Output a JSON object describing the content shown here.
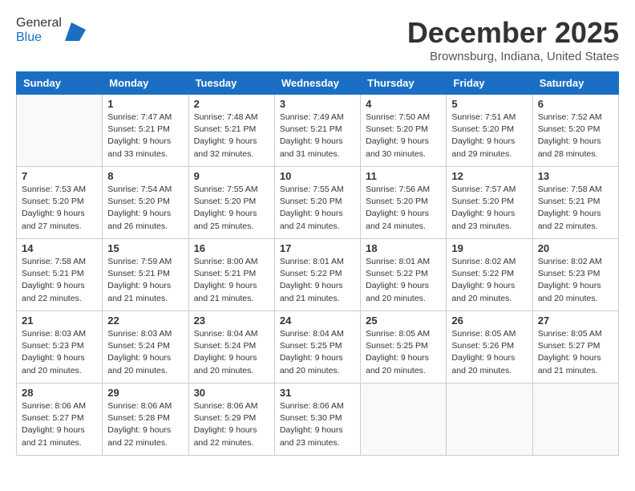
{
  "header": {
    "logo_general": "General",
    "logo_blue": "Blue",
    "month_title": "December 2025",
    "location": "Brownsburg, Indiana, United States"
  },
  "days_of_week": [
    "Sunday",
    "Monday",
    "Tuesday",
    "Wednesday",
    "Thursday",
    "Friday",
    "Saturday"
  ],
  "weeks": [
    [
      {
        "day": "",
        "info": ""
      },
      {
        "day": "1",
        "info": "Sunrise: 7:47 AM\nSunset: 5:21 PM\nDaylight: 9 hours\nand 33 minutes."
      },
      {
        "day": "2",
        "info": "Sunrise: 7:48 AM\nSunset: 5:21 PM\nDaylight: 9 hours\nand 32 minutes."
      },
      {
        "day": "3",
        "info": "Sunrise: 7:49 AM\nSunset: 5:21 PM\nDaylight: 9 hours\nand 31 minutes."
      },
      {
        "day": "4",
        "info": "Sunrise: 7:50 AM\nSunset: 5:20 PM\nDaylight: 9 hours\nand 30 minutes."
      },
      {
        "day": "5",
        "info": "Sunrise: 7:51 AM\nSunset: 5:20 PM\nDaylight: 9 hours\nand 29 minutes."
      },
      {
        "day": "6",
        "info": "Sunrise: 7:52 AM\nSunset: 5:20 PM\nDaylight: 9 hours\nand 28 minutes."
      }
    ],
    [
      {
        "day": "7",
        "info": "Sunrise: 7:53 AM\nSunset: 5:20 PM\nDaylight: 9 hours\nand 27 minutes."
      },
      {
        "day": "8",
        "info": "Sunrise: 7:54 AM\nSunset: 5:20 PM\nDaylight: 9 hours\nand 26 minutes."
      },
      {
        "day": "9",
        "info": "Sunrise: 7:55 AM\nSunset: 5:20 PM\nDaylight: 9 hours\nand 25 minutes."
      },
      {
        "day": "10",
        "info": "Sunrise: 7:55 AM\nSunset: 5:20 PM\nDaylight: 9 hours\nand 24 minutes."
      },
      {
        "day": "11",
        "info": "Sunrise: 7:56 AM\nSunset: 5:20 PM\nDaylight: 9 hours\nand 24 minutes."
      },
      {
        "day": "12",
        "info": "Sunrise: 7:57 AM\nSunset: 5:20 PM\nDaylight: 9 hours\nand 23 minutes."
      },
      {
        "day": "13",
        "info": "Sunrise: 7:58 AM\nSunset: 5:21 PM\nDaylight: 9 hours\nand 22 minutes."
      }
    ],
    [
      {
        "day": "14",
        "info": "Sunrise: 7:58 AM\nSunset: 5:21 PM\nDaylight: 9 hours\nand 22 minutes."
      },
      {
        "day": "15",
        "info": "Sunrise: 7:59 AM\nSunset: 5:21 PM\nDaylight: 9 hours\nand 21 minutes."
      },
      {
        "day": "16",
        "info": "Sunrise: 8:00 AM\nSunset: 5:21 PM\nDaylight: 9 hours\nand 21 minutes."
      },
      {
        "day": "17",
        "info": "Sunrise: 8:01 AM\nSunset: 5:22 PM\nDaylight: 9 hours\nand 21 minutes."
      },
      {
        "day": "18",
        "info": "Sunrise: 8:01 AM\nSunset: 5:22 PM\nDaylight: 9 hours\nand 20 minutes."
      },
      {
        "day": "19",
        "info": "Sunrise: 8:02 AM\nSunset: 5:22 PM\nDaylight: 9 hours\nand 20 minutes."
      },
      {
        "day": "20",
        "info": "Sunrise: 8:02 AM\nSunset: 5:23 PM\nDaylight: 9 hours\nand 20 minutes."
      }
    ],
    [
      {
        "day": "21",
        "info": "Sunrise: 8:03 AM\nSunset: 5:23 PM\nDaylight: 9 hours\nand 20 minutes."
      },
      {
        "day": "22",
        "info": "Sunrise: 8:03 AM\nSunset: 5:24 PM\nDaylight: 9 hours\nand 20 minutes."
      },
      {
        "day": "23",
        "info": "Sunrise: 8:04 AM\nSunset: 5:24 PM\nDaylight: 9 hours\nand 20 minutes."
      },
      {
        "day": "24",
        "info": "Sunrise: 8:04 AM\nSunset: 5:25 PM\nDaylight: 9 hours\nand 20 minutes."
      },
      {
        "day": "25",
        "info": "Sunrise: 8:05 AM\nSunset: 5:25 PM\nDaylight: 9 hours\nand 20 minutes."
      },
      {
        "day": "26",
        "info": "Sunrise: 8:05 AM\nSunset: 5:26 PM\nDaylight: 9 hours\nand 20 minutes."
      },
      {
        "day": "27",
        "info": "Sunrise: 8:05 AM\nSunset: 5:27 PM\nDaylight: 9 hours\nand 21 minutes."
      }
    ],
    [
      {
        "day": "28",
        "info": "Sunrise: 8:06 AM\nSunset: 5:27 PM\nDaylight: 9 hours\nand 21 minutes."
      },
      {
        "day": "29",
        "info": "Sunrise: 8:06 AM\nSunset: 5:28 PM\nDaylight: 9 hours\nand 22 minutes."
      },
      {
        "day": "30",
        "info": "Sunrise: 8:06 AM\nSunset: 5:29 PM\nDaylight: 9 hours\nand 22 minutes."
      },
      {
        "day": "31",
        "info": "Sunrise: 8:06 AM\nSunset: 5:30 PM\nDaylight: 9 hours\nand 23 minutes."
      },
      {
        "day": "",
        "info": ""
      },
      {
        "day": "",
        "info": ""
      },
      {
        "day": "",
        "info": ""
      }
    ]
  ]
}
